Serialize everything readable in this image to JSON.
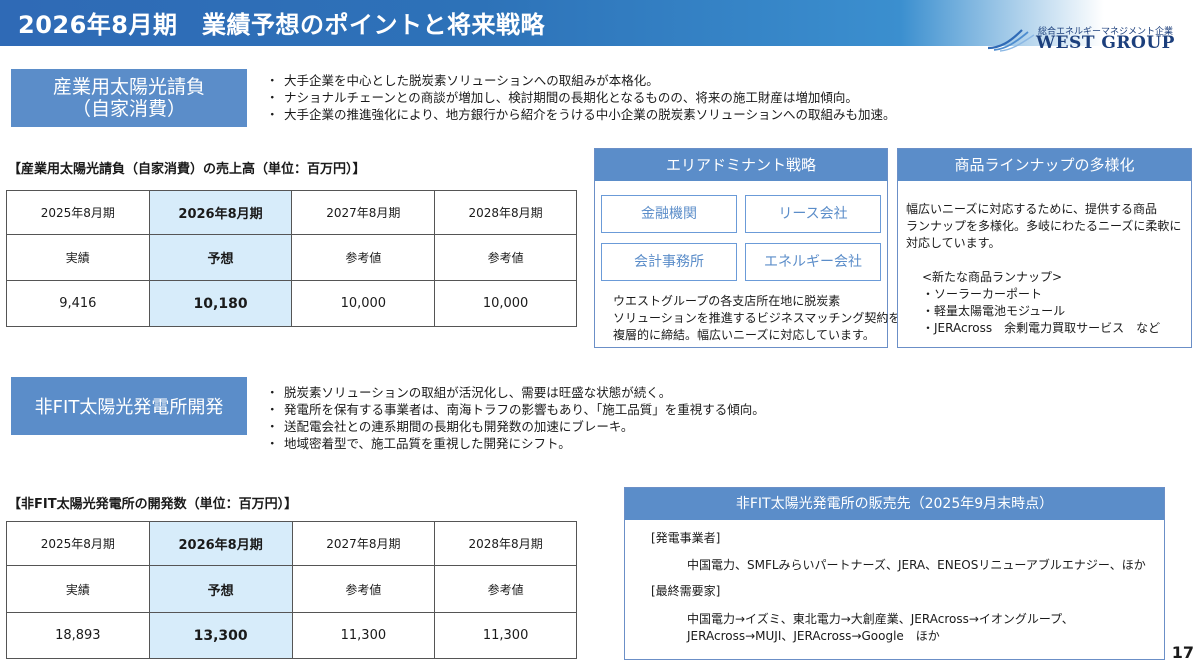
{
  "header": {
    "title": "2026年8月期　業績予想のポイントと将来戦略",
    "logo_sub": "総合エネルギーマネジメント企業",
    "logo_main": "WEST GROUP"
  },
  "section1": {
    "label_line1": "産業用太陽光請負",
    "label_line2": "（自家消費）",
    "bullets": [
      "大手企業を中心とした脱炭素ソリューションへの取組みが本格化。",
      "ナショナルチェーンとの商談が増加し、検討期間の長期化となるものの、将来の施工財産は増加傾向。",
      "大手企業の推進強化により、地方銀行から紹介をうける中小企業の脱炭素ソリューションへの取組みも加速。"
    ]
  },
  "table1": {
    "title": "【産業用太陽光請負（自家消費）の売上高（単位：百万円）】",
    "headers": [
      "2025年8月期",
      "2026年8月期",
      "2027年8月期",
      "2028年8月期"
    ],
    "types": [
      "実績",
      "予想",
      "参考値",
      "参考値"
    ],
    "values": [
      "9,416",
      "10,180",
      "10,000",
      "10,000"
    ]
  },
  "area_panel": {
    "title": "エリアドミナント戦略",
    "tags": [
      "金融機関",
      "リース会社",
      "会計事務所",
      "エネルギー会社"
    ],
    "text_lines": [
      "ウエストグループの各支店所在地に脱炭素",
      "ソリューションを推進するビジネスマッチング契約を",
      "複層的に締結。幅広いニーズに対応しています。"
    ]
  },
  "lineup_panel": {
    "title": "商品ラインナップの多様化",
    "text_lines": [
      "幅広いニーズに対応するために、提供する商品",
      "ランナップを多様化。多岐にわたるニーズに柔軟に",
      "対応しています。"
    ],
    "list_lines": [
      "<新たな商品ランナップ>",
      "・ソーラーカーポート",
      "・軽量太陽電池モジュール",
      "・JERAcross　余剰電力買取サービス　など"
    ]
  },
  "section2": {
    "label": "非FIT太陽光発電所開発",
    "bullets": [
      "脱炭素ソリューションの取組が活況化し、需要は旺盛な状態が続く。",
      "発電所を保有する事業者は、南海トラフの影響もあり、「施工品質」を重視する傾向。",
      "送配電会社との連系期間の長期化も開発数の加速にブレーキ。",
      "地域密着型で、施工品質を重視した開発にシフト。"
    ]
  },
  "table2": {
    "title": "【非FIT太陽光発電所の開発数（単位：百万円）】",
    "headers": [
      "2025年8月期",
      "2026年8月期",
      "2027年8月期",
      "2028年8月期"
    ],
    "types": [
      "実績",
      "予想",
      "参考値",
      "参考値"
    ],
    "values": [
      "18,893",
      "13,300",
      "11,300",
      "11,300"
    ]
  },
  "sales_panel": {
    "title": "非FIT太陽光発電所の販売先（2025年9月末時点）",
    "cat1": "[発電事業者]",
    "cat1_text": "中国電力、SMFLみらいパートナーズ、JERA、ENEOSリニューアブルエナジー、ほか",
    "cat2": "[最終需要家]",
    "cat2_line1": "中国電力→イズミ、東北電力→大創産業、JERAcross→イオングループ、",
    "cat2_line2": "JERAcross→MUJI、JERAcross→Google　ほか"
  },
  "page_number": "17",
  "colors": {
    "header_blue": "#2f6ab6",
    "section_blue": "#5b8dc9",
    "highlight_cell": "#d7ecfa",
    "logo_navy": "#1c3f7c"
  }
}
